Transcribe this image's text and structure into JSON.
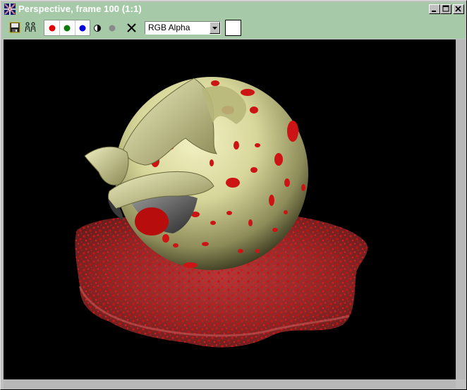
{
  "window": {
    "title": "Perspective, frame 100 (1:1)",
    "controls": {
      "minimize": "minimize-icon",
      "maximize": "maximize-icon",
      "close": "close-icon"
    }
  },
  "toolbar": {
    "save_icon": "floppy-disk-icon",
    "clone_icon": "clone-people-icon",
    "channels": [
      {
        "name": "red-channel",
        "color": "#e00000"
      },
      {
        "name": "green-channel",
        "color": "#0a7a0a"
      },
      {
        "name": "blue-channel",
        "color": "#0000e0"
      }
    ],
    "alpha_icon": "half-circle-icon",
    "mono_icon": "gray-dot-icon",
    "clear_icon": "x-icon",
    "display_select": {
      "value": "RGB Alpha"
    },
    "color_swatch": "#ffffff"
  },
  "colors": {
    "title_bar": "#a6caa8",
    "toolbar": "#a6caa8",
    "viewport_bg": "#000000",
    "sphere": "#d7d69a",
    "blood": "#c41212"
  }
}
